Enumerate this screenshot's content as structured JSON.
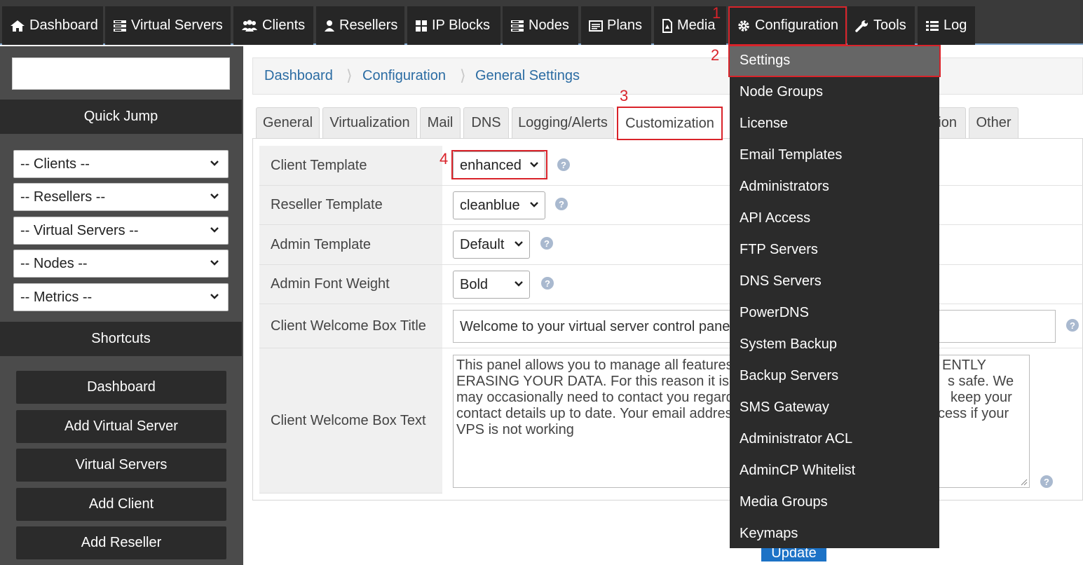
{
  "nav": [
    {
      "label": "Dashboard",
      "icon": "home-icon"
    },
    {
      "label": "Virtual Servers",
      "icon": "server-icon"
    },
    {
      "label": "Clients",
      "icon": "users-icon"
    },
    {
      "label": "Resellers",
      "icon": "user-icon"
    },
    {
      "label": "IP Blocks",
      "icon": "grid-icon"
    },
    {
      "label": "Nodes",
      "icon": "server-icon"
    },
    {
      "label": "Plans",
      "icon": "list-card-icon"
    },
    {
      "label": "Media",
      "icon": "file-icon"
    },
    {
      "label": "Configuration",
      "icon": "gear-icon"
    },
    {
      "label": "Tools",
      "icon": "wrench-icon"
    },
    {
      "label": "Log",
      "icon": "list-icon"
    }
  ],
  "sidebar": {
    "search_value": "",
    "quick_jump_title": "Quick Jump",
    "selects": [
      "-- Clients --",
      "-- Resellers --",
      "-- Virtual Servers --",
      "-- Nodes --",
      "-- Metrics --"
    ],
    "shortcuts_title": "Shortcuts",
    "shortcuts": [
      "Dashboard",
      "Add Virtual Server",
      "Virtual Servers",
      "Add Client",
      "Add Reseller"
    ]
  },
  "breadcrumb": [
    "Dashboard",
    "Configuration",
    "General Settings"
  ],
  "tabs": {
    "general": "General",
    "virtualization": "Virtualization",
    "mail": "Mail",
    "dns": "DNS",
    "logging": "Logging/Alerts",
    "customization": "Customization",
    "hidden_partial": "ion",
    "other": "Other"
  },
  "form": {
    "client_template": {
      "label": "Client Template",
      "value": "enhanced"
    },
    "reseller_template": {
      "label": "Reseller Template",
      "value": "cleanblue"
    },
    "admin_template": {
      "label": "Admin Template",
      "value": "Default"
    },
    "admin_font_weight": {
      "label": "Admin Font Weight",
      "value": "Bold"
    },
    "welcome_title": {
      "label": "Client Welcome Box Title",
      "value": "Welcome to your virtual server control panel"
    },
    "welcome_text": {
      "label": "Client Welcome Box Text",
      "lines": [
        "This panel allows you to manage all features",
        "ERASING YOUR DATA. For this reason it is v",
        "may occasionally need to contact you regardi",
        "contact details up to date. Your email address",
        "VPS is not working"
      ],
      "right_fragments": [
        "ENTLY",
        "s safe. We",
        "keep your",
        "ccess if your"
      ]
    }
  },
  "help_glyph": "?",
  "update_label": "Update",
  "config_menu": [
    "Settings",
    "Node Groups",
    "License",
    "Email Templates",
    "Administrators",
    "API Access",
    "FTP Servers",
    "DNS Servers",
    "PowerDNS",
    "System Backup",
    "Backup Servers",
    "SMS Gateway",
    "Administrator ACL",
    "AdminCP Whitelist",
    "Media Groups",
    "Keymaps"
  ],
  "annotations": [
    "1",
    "2",
    "3",
    "4"
  ],
  "colors": {
    "annotation": "#d9232a",
    "link": "#2b6ca3",
    "nav_bg": "#262626",
    "menu_bg": "#2b2b2b",
    "accent_button": "#1c72c6"
  }
}
